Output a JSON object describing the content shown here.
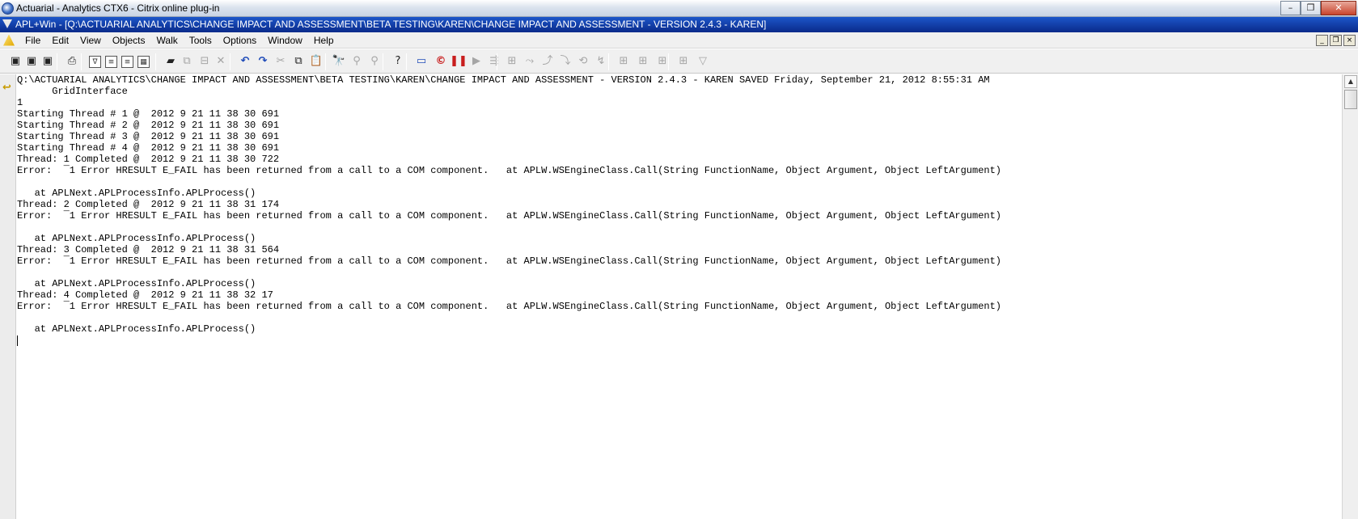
{
  "outer_window": {
    "title": "Actuarial - Analytics CTX6 - Citrix online plug-in",
    "icon": "citrix-icon",
    "controls": [
      "minimize",
      "maximize",
      "close"
    ]
  },
  "inner_window": {
    "title": "APL+Win - [Q:\\ACTUARIAL ANALYTICS\\CHANGE IMPACT AND ASSESSMENT\\BETA TESTING\\KAREN\\CHANGE IMPACT AND ASSESSMENT - VERSION 2.4.3 - KAREN]",
    "icon": "apl-triangle-icon"
  },
  "menubar": {
    "items": [
      "File",
      "Edit",
      "View",
      "Objects",
      "Walk",
      "Tools",
      "Options",
      "Window",
      "Help"
    ]
  },
  "mdi_controls": {
    "minimize": "_",
    "restore": "❐",
    "close": "×"
  },
  "toolbar": {
    "buttons": [
      {
        "name": "open-workspace-icon",
        "glyph": "▣",
        "style": "dark"
      },
      {
        "name": "load-workspace-icon",
        "glyph": "▣",
        "style": "dark"
      },
      {
        "name": "save-workspace-icon",
        "glyph": "▣",
        "style": "dark"
      },
      {
        "name": "print-icon",
        "glyph": "⎙",
        "style": "dark"
      },
      {
        "name": "edit-function-icon",
        "glyph": "∇",
        "style": "box"
      },
      {
        "name": "edit-variable-icon",
        "glyph": "≡",
        "style": "box"
      },
      {
        "name": "edit-text-icon",
        "glyph": "≡",
        "style": "box"
      },
      {
        "name": "edit-matrix-icon",
        "glyph": "▦",
        "style": "box"
      },
      {
        "name": "open-folder-icon",
        "glyph": "▰",
        "style": "dark"
      },
      {
        "name": "copy-object-icon",
        "glyph": "⧉",
        "style": "disabled"
      },
      {
        "name": "erase-object-icon",
        "glyph": "⊟",
        "style": "disabled"
      },
      {
        "name": "delete-object-icon",
        "glyph": "✕",
        "style": "disabled"
      },
      {
        "name": "undo-icon",
        "glyph": "↶",
        "style": "blue"
      },
      {
        "name": "redo-icon",
        "glyph": "↷",
        "style": "blue"
      },
      {
        "name": "cut-icon",
        "glyph": "✂",
        "style": "disabled"
      },
      {
        "name": "copy-icon",
        "glyph": "⧉",
        "style": "dark"
      },
      {
        "name": "paste-icon",
        "glyph": "📋",
        "style": "dark"
      },
      {
        "name": "find-icon",
        "glyph": "🔭",
        "style": "dark"
      },
      {
        "name": "find-next-icon",
        "glyph": "⚲",
        "style": "disabled"
      },
      {
        "name": "replace-icon",
        "glyph": "⚲",
        "style": "disabled"
      },
      {
        "name": "help-icon",
        "glyph": "?",
        "style": "dark"
      },
      {
        "name": "window-layout-icon",
        "glyph": "▭",
        "style": "blue"
      },
      {
        "name": "stop-circle-icon",
        "glyph": "©",
        "style": "red"
      },
      {
        "name": "pause-icon",
        "glyph": "❚❚",
        "style": "red"
      },
      {
        "name": "run-icon",
        "glyph": "▶",
        "style": "disabled"
      },
      {
        "name": "run-to-icon",
        "glyph": "⇶",
        "style": "disabled"
      },
      {
        "name": "step-into-icon",
        "glyph": "⊞",
        "style": "disabled"
      },
      {
        "name": "step-over-icon",
        "glyph": "⤳",
        "style": "disabled"
      },
      {
        "name": "step-out-icon",
        "glyph": "⤴",
        "style": "disabled"
      },
      {
        "name": "trace-icon",
        "glyph": "⤵",
        "style": "disabled"
      },
      {
        "name": "stop-trace-icon",
        "glyph": "⟲",
        "style": "disabled"
      },
      {
        "name": "restart-icon",
        "glyph": "↯",
        "style": "disabled"
      },
      {
        "name": "breakpoint-icon",
        "glyph": "⊞",
        "style": "disabled"
      },
      {
        "name": "watch-icon",
        "glyph": "⊞",
        "style": "disabled"
      },
      {
        "name": "clear-breakpoints-icon",
        "glyph": "⊞",
        "style": "disabled"
      },
      {
        "name": "stack-icon",
        "glyph": "⊞",
        "style": "disabled"
      },
      {
        "name": "dropdown-icon",
        "glyph": "▽",
        "style": "disabled"
      }
    ]
  },
  "session": {
    "gutter_icon": "return-arrow-icon",
    "lines": [
      "Q:\\ACTUARIAL ANALYTICS\\CHANGE IMPACT AND ASSESSMENT\\BETA TESTING\\KAREN\\CHANGE IMPACT AND ASSESSMENT - VERSION 2.4.3 - KAREN SAVED Friday, September 21, 2012 8:55:31 AM",
      "      GridInterface",
      "1",
      "Starting Thread # 1 @  2012 9 21 11 38 30 691",
      "Starting Thread # 2 @  2012 9 21 11 38 30 691",
      "Starting Thread # 3 @  2012 9 21 11 38 30 691",
      "Starting Thread # 4 @  2012 9 21 11 38 30 691",
      "Thread: 1 Completed @  2012 9 21 11 38 30 722",
      "Error:  ¯1 Error HRESULT E_FAIL has been returned from a call to a COM component.   at APLW.WSEngineClass.Call(String FunctionName, Object Argument, Object LeftArgument)",
      "",
      "   at APLNext.APLProcessInfo.APLProcess()",
      "Thread: 2 Completed @  2012 9 21 11 38 31 174",
      "Error:  ¯1 Error HRESULT E_FAIL has been returned from a call to a COM component.   at APLW.WSEngineClass.Call(String FunctionName, Object Argument, Object LeftArgument)",
      "",
      "   at APLNext.APLProcessInfo.APLProcess()",
      "Thread: 3 Completed @  2012 9 21 11 38 31 564",
      "Error:  ¯1 Error HRESULT E_FAIL has been returned from a call to a COM component.   at APLW.WSEngineClass.Call(String FunctionName, Object Argument, Object LeftArgument)",
      "",
      "   at APLNext.APLProcessInfo.APLProcess()",
      "Thread: 4 Completed @  2012 9 21 11 38 32 17",
      "Error:  ¯1 Error HRESULT E_FAIL has been returned from a call to a COM component.   at APLW.WSEngineClass.Call(String FunctionName, Object Argument, Object LeftArgument)",
      "",
      "   at APLNext.APLProcessInfo.APLProcess()"
    ]
  }
}
